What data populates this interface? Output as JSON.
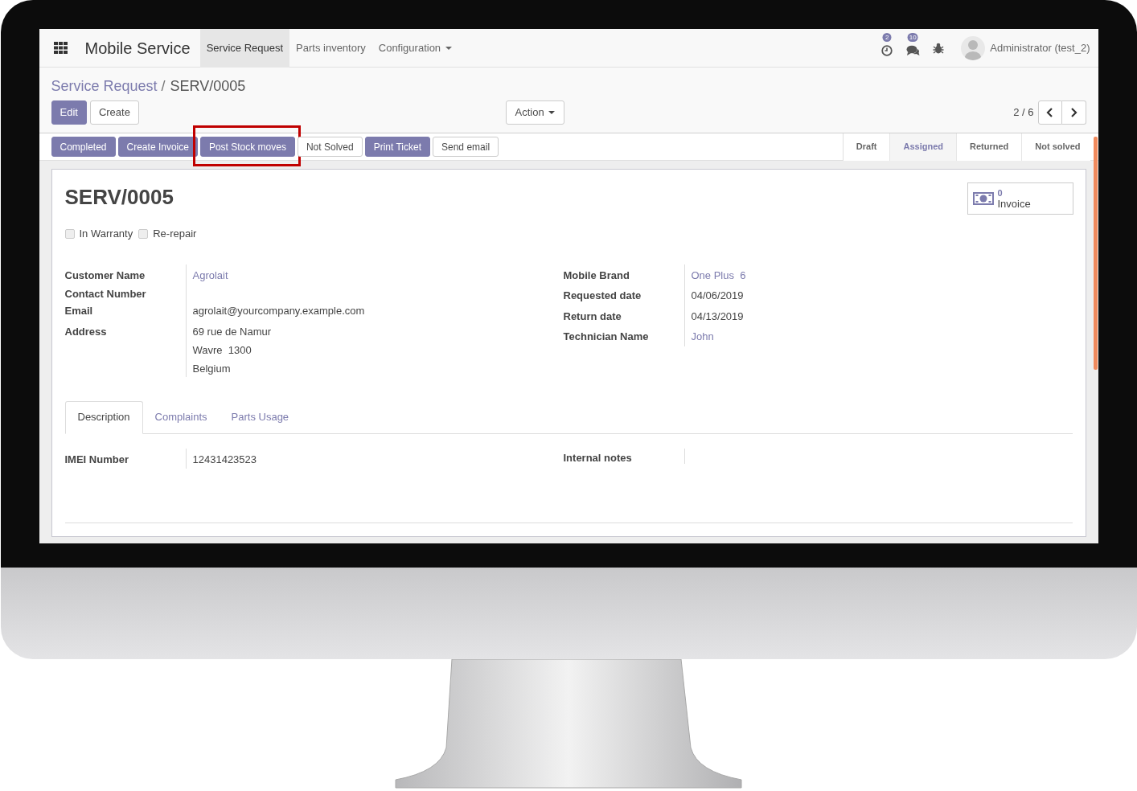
{
  "navbar": {
    "brand": "Mobile Service",
    "menu": [
      {
        "label": "Service Request",
        "selected": true,
        "dropdown": false
      },
      {
        "label": "Parts inventory",
        "selected": false,
        "dropdown": false
      },
      {
        "label": "Configuration",
        "selected": false,
        "dropdown": true
      }
    ],
    "activity_count": "2",
    "message_count": "10",
    "user": "Administrator (test_2)"
  },
  "breadcrumb": [
    {
      "label": "Service Request",
      "separator": "/"
    },
    {
      "label": "SERV/0005"
    }
  ],
  "control_buttons": [
    {
      "label": "Edit",
      "kind": "primary"
    },
    {
      "label": "Create",
      "kind": "secondary"
    }
  ],
  "action_menu": "Action",
  "pager": "2 / 6",
  "header_buttons": [
    {
      "label": "Completed",
      "kind": "primary",
      "highlighted": false
    },
    {
      "label": "Create Invoice",
      "kind": "primary",
      "highlighted": false
    },
    {
      "label": "Post Stock moves",
      "kind": "primary",
      "highlighted": true
    },
    {
      "label": "Not Solved",
      "kind": "secondary",
      "highlighted": false
    },
    {
      "label": "Print Ticket",
      "kind": "primary",
      "highlighted": false
    },
    {
      "label": "Send email",
      "kind": "secondary",
      "highlighted": false
    }
  ],
  "stages": [
    {
      "label": "Draft",
      "selected": false
    },
    {
      "label": "Assigned",
      "selected": true
    },
    {
      "label": "Returned",
      "selected": false
    },
    {
      "label": "Not solved",
      "selected": false
    }
  ],
  "record": {
    "title": "SERV/0005",
    "checkboxes": [
      {
        "label": "In Warranty",
        "checked": false
      },
      {
        "label": "Re-repair",
        "checked": false
      }
    ],
    "stat_button": {
      "value": "0",
      "label": "Invoice"
    },
    "left_fields": [
      {
        "label": "Customer Name",
        "kind": "link",
        "lines": [
          "Agrolait"
        ]
      },
      {
        "label": "Contact Number"
      },
      {
        "label": "Email",
        "kind": "text",
        "lines": [
          "agrolait@yourcompany.example.com"
        ]
      },
      {
        "label": "Address",
        "kind": "text",
        "lines": [
          "69 rue de Namur",
          "Wavre  1300",
          "Belgium"
        ]
      }
    ],
    "right_fields": [
      {
        "label": "Mobile Brand",
        "kind": "link",
        "lines": [
          "One Plus  6"
        ]
      },
      {
        "label": "Requested date",
        "kind": "text",
        "lines": [
          "04/06/2019"
        ]
      },
      {
        "label": "Return date",
        "kind": "text",
        "lines": [
          "04/13/2019"
        ]
      },
      {
        "label": "Technician Name",
        "kind": "link",
        "lines": [
          "John"
        ]
      }
    ],
    "tabs": [
      {
        "label": "Description",
        "selected": true
      },
      {
        "label": "Complaints",
        "selected": false
      },
      {
        "label": "Parts Usage",
        "selected": false
      }
    ],
    "tab_fields": [
      {
        "label": "IMEI Number",
        "lines": [
          "12431423523"
        ]
      },
      {
        "label": "Internal notes"
      }
    ]
  }
}
